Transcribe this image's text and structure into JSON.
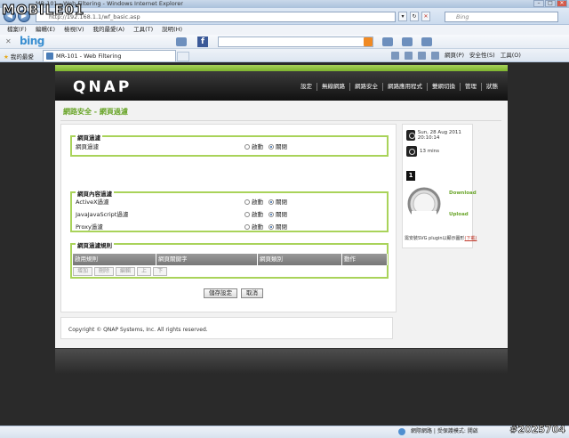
{
  "browser": {
    "title": "MR-101 - Web Filtering - Windows Internet Explorer",
    "url": "http://192.168.1.1/wf_basic.asp",
    "search_engine": "Bing",
    "menu": [
      "檔案(F)",
      "編輯(E)",
      "檢視(V)",
      "我的最愛(A)",
      "工具(T)",
      "說明(H)"
    ],
    "favorites_label": "我的最愛",
    "tab_title": "MR-101 - Web Filtering",
    "commands": [
      "網頁(P)",
      "安全性(S)",
      "工具(O)"
    ],
    "status": {
      "zone": "網際網路 | 受保護模式: 開啟"
    }
  },
  "toolbar": {
    "brand": "bing"
  },
  "router": {
    "logo": "QNAP",
    "nav": [
      "設定",
      "無線網路",
      "網路安全",
      "網路應用程式",
      "雙網切換",
      "管理",
      "狀態"
    ],
    "breadcrumb": "網路安全 - 網頁過濾",
    "sections": {
      "web_filter": {
        "title": "網頁過濾",
        "rows": [
          {
            "label": "網頁過濾",
            "on_label": "啟動",
            "off_label": "關閉",
            "selected": "off"
          }
        ]
      },
      "content_filter": {
        "title": "網頁內容過濾",
        "rows": [
          {
            "label": "ActiveX過濾",
            "on_label": "啟動",
            "off_label": "關閉",
            "selected": "off"
          },
          {
            "label": "JavaJavaScript過濾",
            "on_label": "啟動",
            "off_label": "關閉",
            "selected": "off"
          },
          {
            "label": "Proxy過濾",
            "on_label": "啟動",
            "off_label": "關閉",
            "selected": "off"
          }
        ]
      },
      "rules": {
        "title": "網頁過濾規則",
        "columns": [
          "啟用規則",
          "網頁關鍵字",
          "網頁類別",
          "動作"
        ],
        "buttons": [
          "增加",
          "刪除",
          "編輯",
          "上",
          "下"
        ]
      }
    },
    "actions": {
      "save": "儲存設定",
      "cancel": "取消"
    },
    "side": {
      "datetime": "Sun, 28 Aug 2011 20:10:14",
      "uptime": "13 mins",
      "badge": "1",
      "download_label": "Download",
      "upload_label": "Upload",
      "note_prefix": "需安裝SVG plugin以顯示圖形",
      "note_link": "(下載)"
    },
    "footer": "Copyright © QNAP Systems, Inc. All rights reserved."
  },
  "watermark": {
    "logo": "MOBILE01",
    "id": "#2025704"
  }
}
